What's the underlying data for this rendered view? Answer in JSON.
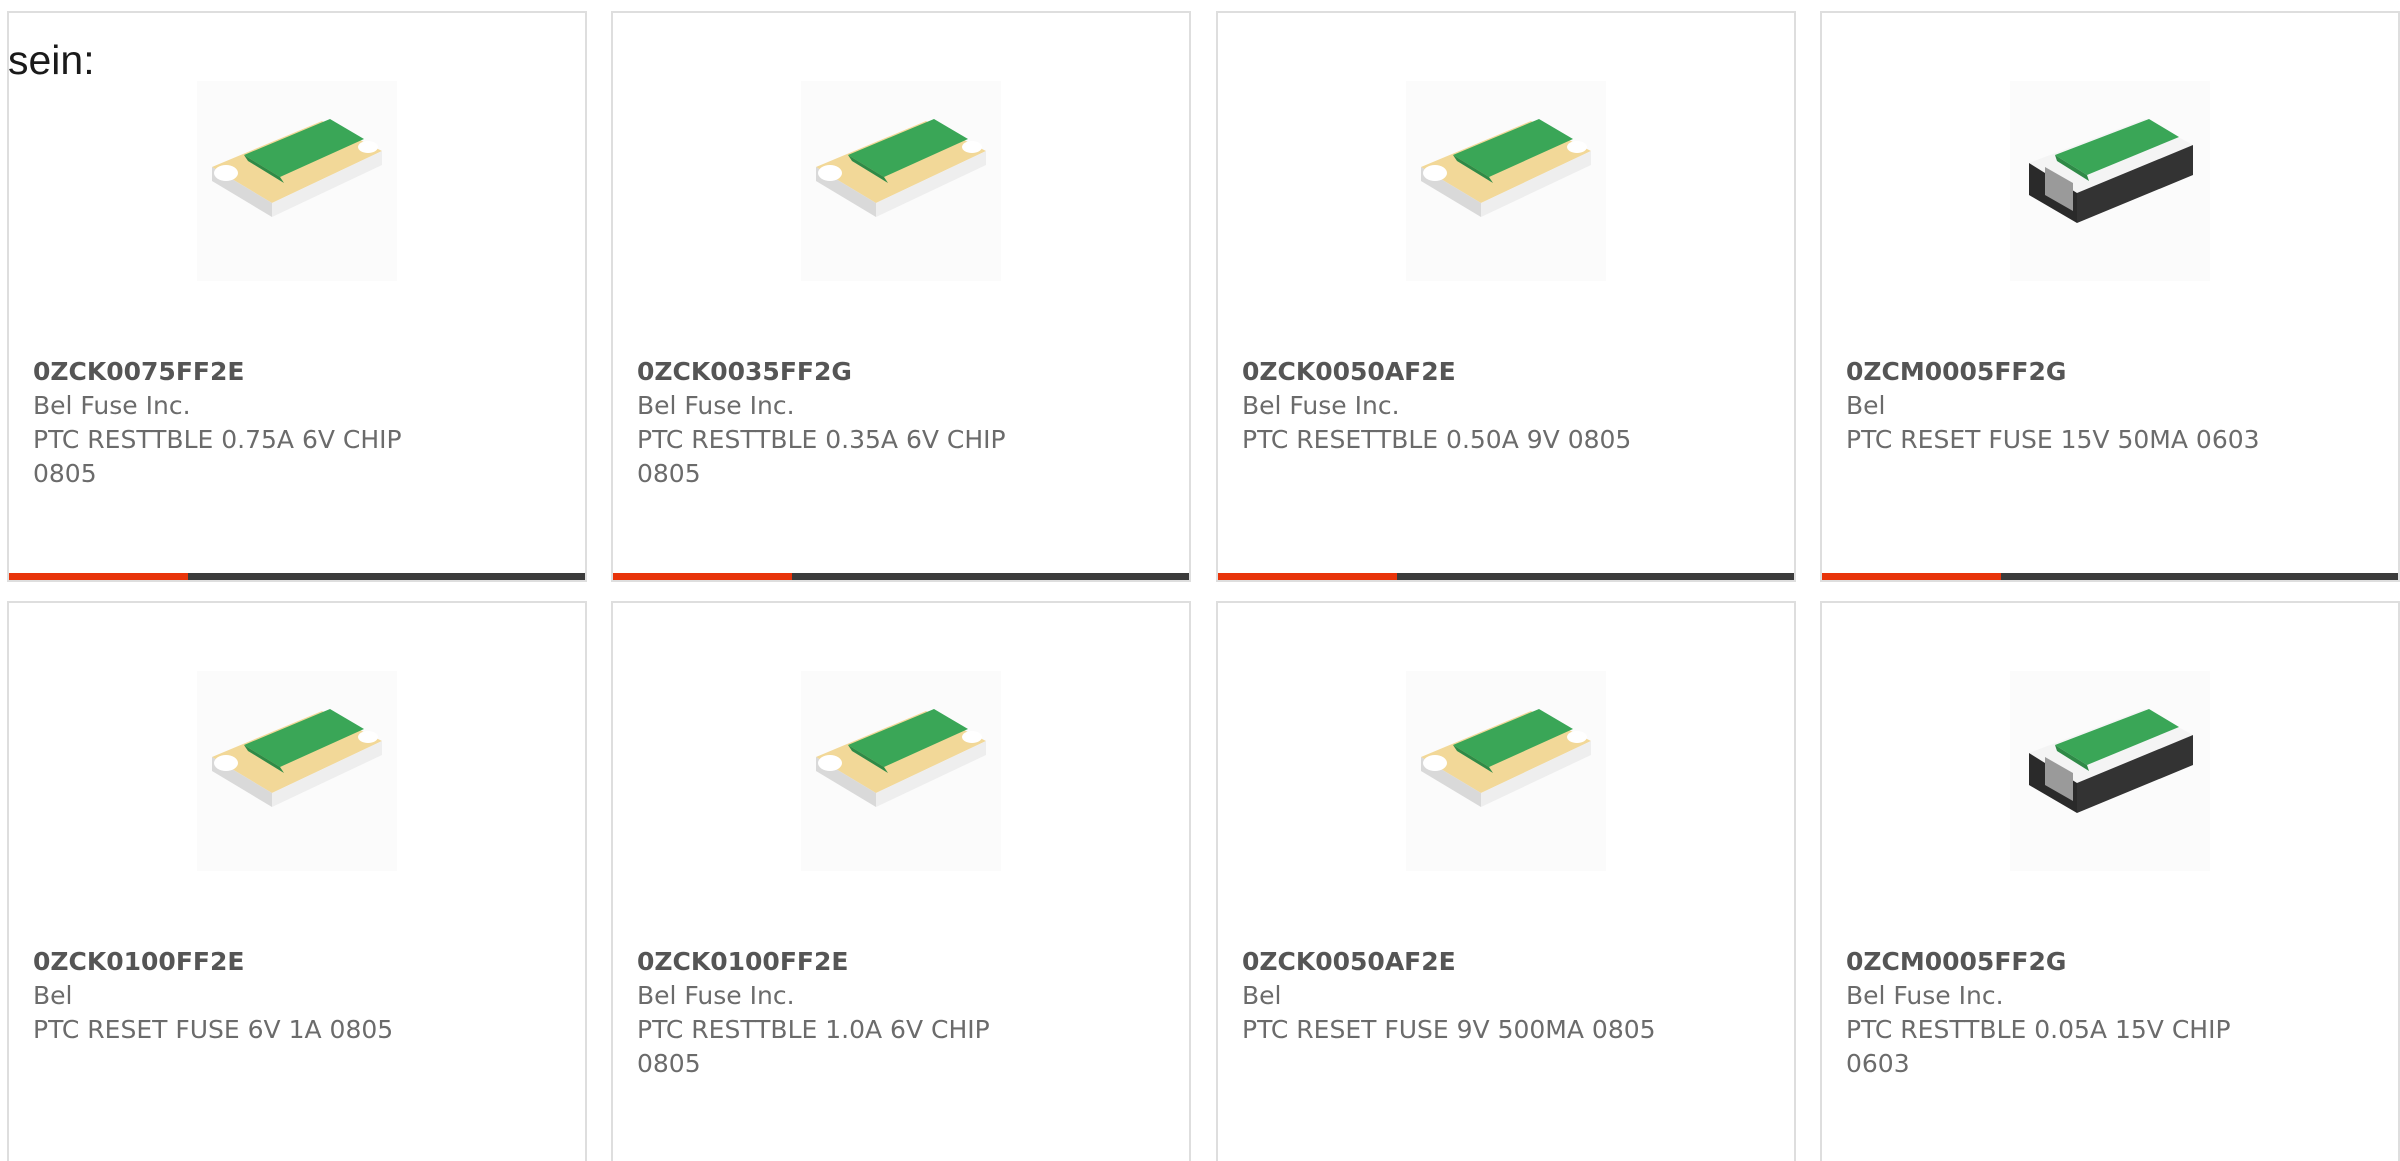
{
  "lead_text": "sein:",
  "colors": {
    "accent": "#e8340a",
    "bar_track": "#3b3b3b",
    "card_border": "#dedede",
    "chip_green": "#3aa657",
    "chip_terminal_gold": "#f2d898",
    "chip_terminal_black": "#2a2a2a"
  },
  "products": [
    {
      "part_number": "0ZCK0075FF2E",
      "manufacturer": "Bel Fuse Inc.",
      "description_line1": "PTC RESTTBLE 0.75A 6V CHIP",
      "description_line2": "0805",
      "image_icon": "ptc-chip-gold-terminal-icon",
      "progress_fraction": 0.31
    },
    {
      "part_number": "0ZCK0035FF2G",
      "manufacturer": "Bel Fuse Inc.",
      "description_line1": "PTC RESTTBLE 0.35A 6V CHIP",
      "description_line2": "0805",
      "image_icon": "ptc-chip-gold-terminal-icon",
      "progress_fraction": 0.31
    },
    {
      "part_number": "0ZCK0050AF2E",
      "manufacturer": "Bel Fuse Inc.",
      "description_line1": "PTC RESETTBLE 0.50A 9V 0805",
      "description_line2": "",
      "image_icon": "ptc-chip-gold-terminal-icon",
      "progress_fraction": 0.31
    },
    {
      "part_number": "0ZCM0005FF2G",
      "manufacturer": "Bel",
      "description_line1": "PTC RESET FUSE 15V 50MA 0603",
      "description_line2": "",
      "image_icon": "ptc-chip-black-terminal-icon",
      "progress_fraction": 0.31
    },
    {
      "part_number": "0ZCK0100FF2E",
      "manufacturer": "Bel",
      "description_line1": "PTC RESET FUSE 6V 1A 0805",
      "description_line2": "",
      "image_icon": "ptc-chip-gold-terminal-icon"
    },
    {
      "part_number": "0ZCK0100FF2E",
      "manufacturer": "Bel Fuse Inc.",
      "description_line1": "PTC RESTTBLE 1.0A 6V CHIP",
      "description_line2": "0805",
      "image_icon": "ptc-chip-gold-terminal-icon"
    },
    {
      "part_number": "0ZCK0050AF2E",
      "manufacturer": "Bel",
      "description_line1": "PTC RESET FUSE 9V 500MA 0805",
      "description_line2": "",
      "image_icon": "ptc-chip-gold-terminal-icon"
    },
    {
      "part_number": "0ZCM0005FF2G",
      "manufacturer": "Bel Fuse Inc.",
      "description_line1": "PTC RESTTBLE 0.05A 15V CHIP",
      "description_line2": "0603",
      "image_icon": "ptc-chip-black-terminal-icon"
    }
  ]
}
